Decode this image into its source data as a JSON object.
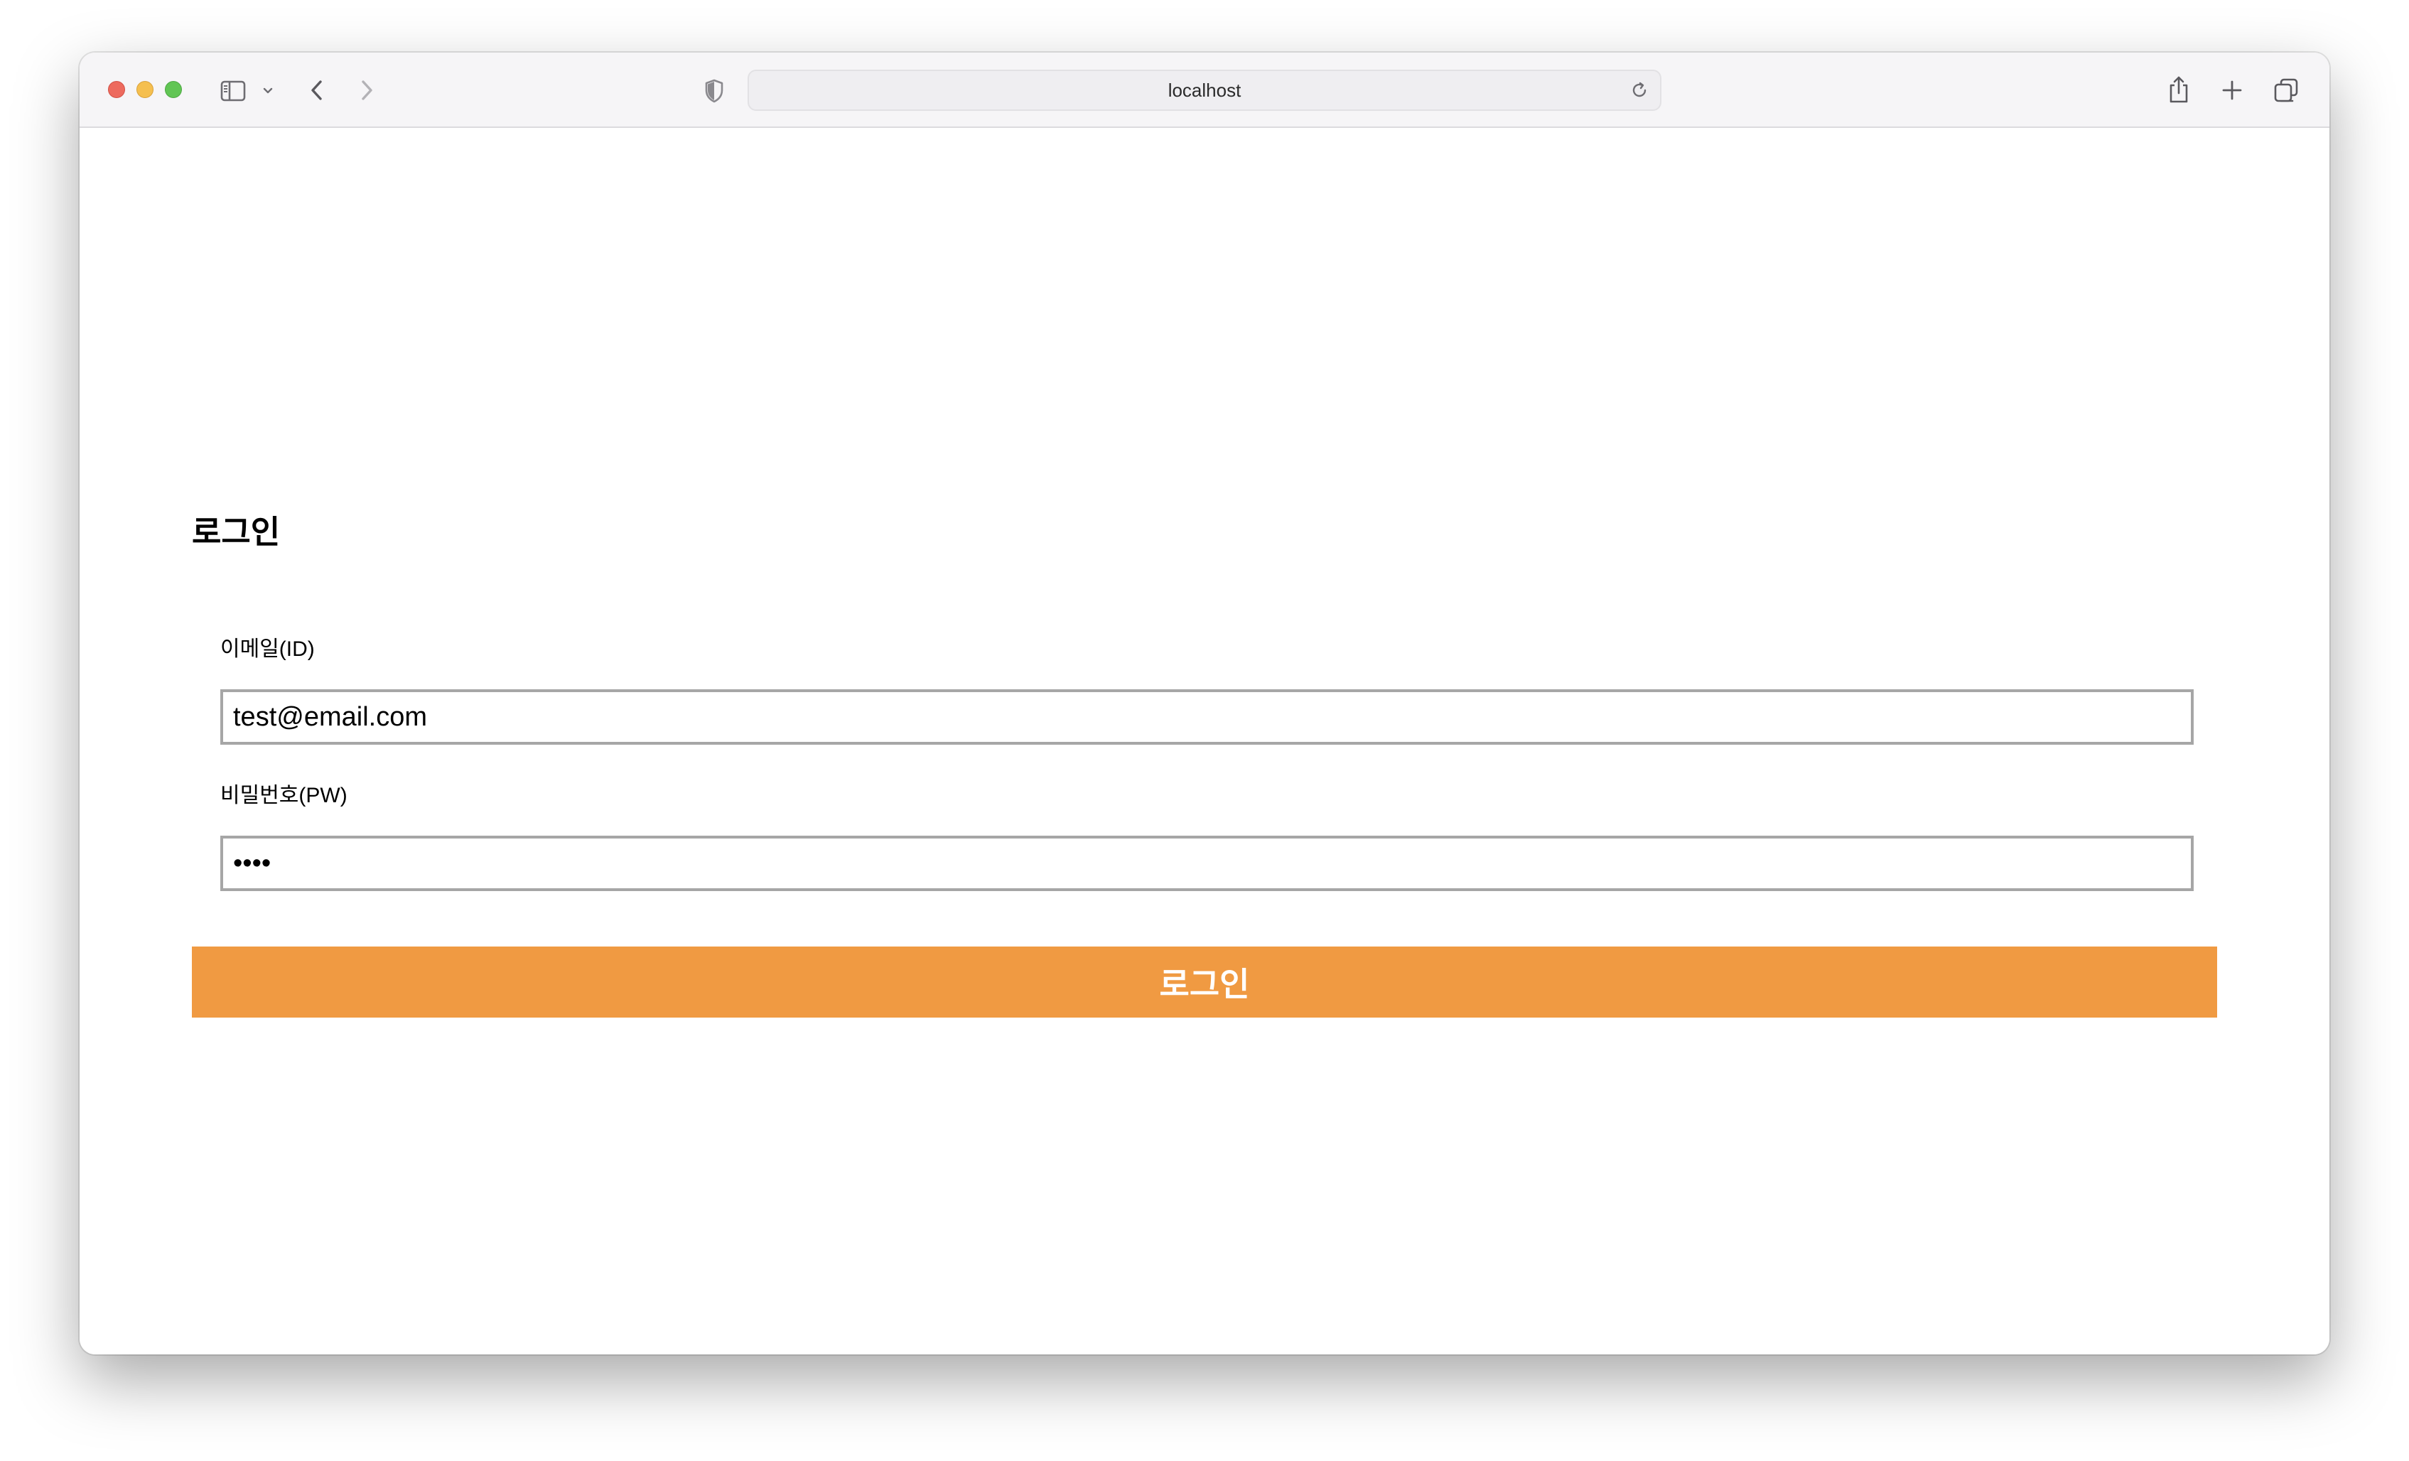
{
  "browser": {
    "url": "localhost",
    "icons": {
      "sidebar": "sidebar-icon",
      "sidebar_menu": "chevron-down-icon",
      "back": "chevron-left-icon",
      "forward": "chevron-right-icon",
      "privacy": "shield-icon",
      "reload": "reload-icon",
      "share": "share-icon",
      "new_tab": "plus-icon",
      "tabs": "tab-overview-icon"
    }
  },
  "login": {
    "title": "로그인",
    "email_label": "이메일(ID)",
    "email_value": "test@email.com",
    "password_label": "비밀번호(PW)",
    "password_value": "1234",
    "submit_label": "로그인"
  },
  "colors": {
    "accent": "#f09a42",
    "input_border": "#a6a6a6"
  }
}
